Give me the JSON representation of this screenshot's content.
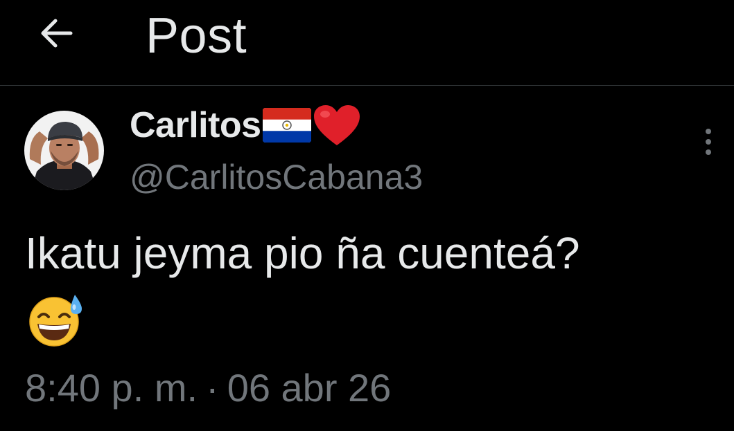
{
  "header": {
    "title": "Post",
    "back_icon": "arrow-left-icon"
  },
  "author": {
    "display_name": "Carlitos",
    "name_emojis": [
      "paraguay-flag-icon",
      "red-heart-icon"
    ],
    "handle": "@CarlitosCabana3",
    "avatar": "avatar-photo"
  },
  "menu": {
    "icon": "more-vertical-icon"
  },
  "tweet": {
    "text": "Ikatu jeyma pio ña cuenteá?",
    "emoji": "grinning-face-with-sweat-icon"
  },
  "meta": {
    "time": "8:40 p. m.",
    "separator": "·",
    "date": "06 abr 26"
  },
  "colors": {
    "background": "#000000",
    "text_primary": "#e7e9ea",
    "text_secondary": "#71767b",
    "divider": "#2f3336"
  }
}
